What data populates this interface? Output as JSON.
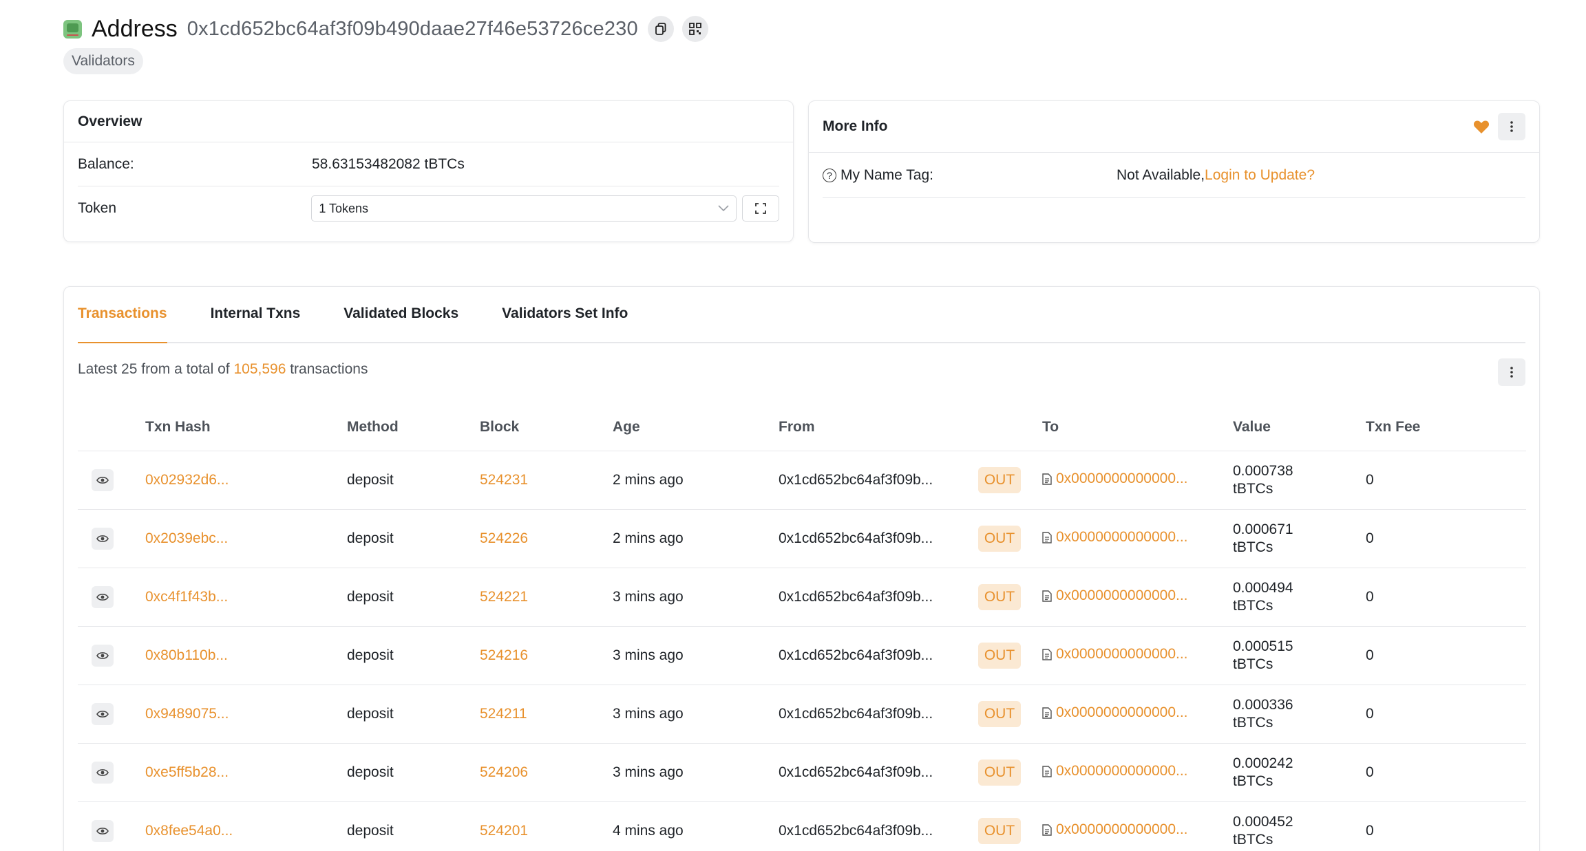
{
  "header": {
    "title": "Address",
    "address": "0x1cd652bc64af3f09b490daae27f46e53726ce230",
    "tag": "Validators"
  },
  "overview": {
    "title": "Overview",
    "balance_label": "Balance:",
    "balance_value": "58.63153482082 tBTCs",
    "token_label": "Token",
    "token_select": "1 Tokens"
  },
  "more_info": {
    "title": "More Info",
    "name_tag_label": "My Name Tag:",
    "name_tag_value": "Not Available,",
    "name_tag_link": "Login to Update?"
  },
  "tabs": [
    {
      "label": "Transactions",
      "active": true
    },
    {
      "label": "Internal Txns",
      "active": false
    },
    {
      "label": "Validated Blocks",
      "active": false
    },
    {
      "label": "Validators Set Info",
      "active": false
    }
  ],
  "summary": {
    "prefix": "Latest 25 from a total of ",
    "count": "105,596",
    "suffix": " transactions"
  },
  "table": {
    "columns": [
      "",
      "Txn Hash",
      "Method",
      "Block",
      "Age",
      "From",
      "",
      "To",
      "Value",
      "Txn Fee"
    ],
    "rows": [
      {
        "hash": "0x02932d6...",
        "method": "deposit",
        "block": "524231",
        "age": "2 mins ago",
        "from": "0x1cd652bc64af3f09b...",
        "dir": "OUT",
        "to": "0x0000000000000...",
        "value": "0.000738",
        "unit": "tBTCs",
        "fee": "0"
      },
      {
        "hash": "0x2039ebc...",
        "method": "deposit",
        "block": "524226",
        "age": "2 mins ago",
        "from": "0x1cd652bc64af3f09b...",
        "dir": "OUT",
        "to": "0x0000000000000...",
        "value": "0.000671",
        "unit": "tBTCs",
        "fee": "0"
      },
      {
        "hash": "0xc4f1f43b...",
        "method": "deposit",
        "block": "524221",
        "age": "3 mins ago",
        "from": "0x1cd652bc64af3f09b...",
        "dir": "OUT",
        "to": "0x0000000000000...",
        "value": "0.000494",
        "unit": "tBTCs",
        "fee": "0"
      },
      {
        "hash": "0x80b110b...",
        "method": "deposit",
        "block": "524216",
        "age": "3 mins ago",
        "from": "0x1cd652bc64af3f09b...",
        "dir": "OUT",
        "to": "0x0000000000000...",
        "value": "0.000515",
        "unit": "tBTCs",
        "fee": "0"
      },
      {
        "hash": "0x9489075...",
        "method": "deposit",
        "block": "524211",
        "age": "3 mins ago",
        "from": "0x1cd652bc64af3f09b...",
        "dir": "OUT",
        "to": "0x0000000000000...",
        "value": "0.000336",
        "unit": "tBTCs",
        "fee": "0"
      },
      {
        "hash": "0xe5ff5b28...",
        "method": "deposit",
        "block": "524206",
        "age": "3 mins ago",
        "from": "0x1cd652bc64af3f09b...",
        "dir": "OUT",
        "to": "0x0000000000000...",
        "value": "0.000242",
        "unit": "tBTCs",
        "fee": "0"
      },
      {
        "hash": "0x8fee54a0...",
        "method": "deposit",
        "block": "524201",
        "age": "4 mins ago",
        "from": "0x1cd652bc64af3f09b...",
        "dir": "OUT",
        "to": "0x0000000000000...",
        "value": "0.000452",
        "unit": "tBTCs",
        "fee": "0"
      }
    ]
  },
  "icons": {
    "address": "address-wallet-icon",
    "copy": "copy-icon",
    "qr": "qr-code-icon",
    "expand": "expand-icon",
    "heart": "heart-icon",
    "kebab": "kebab-menu-icon",
    "eye": "eye-icon",
    "doc": "contract-doc-icon"
  },
  "colors": {
    "accent": "#e8912d",
    "badge_bg": "#fbe9d3",
    "text": "#1f2328",
    "muted": "#4d5259"
  }
}
